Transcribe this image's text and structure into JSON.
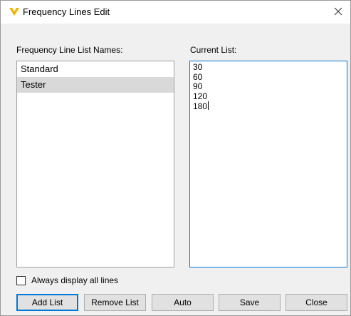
{
  "window": {
    "title": "Frequency Lines Edit"
  },
  "left_panel": {
    "label": "Frequency Line List Names:",
    "items": [
      {
        "label": "Standard",
        "selected": false
      },
      {
        "label": "Tester",
        "selected": true
      }
    ]
  },
  "right_panel": {
    "label": "Current List:",
    "lines": [
      "30",
      "60",
      "90",
      "120",
      "180"
    ]
  },
  "options": {
    "always_display_label": "Always display all lines",
    "always_display_checked": false
  },
  "buttons": {
    "add_list": "Add List",
    "remove_list": "Remove List",
    "auto": "Auto",
    "save": "Save",
    "close": "Close"
  },
  "colors": {
    "accent": "#0078d7",
    "selection": "#d9d9d9",
    "logo_gold": "#f0b400"
  },
  "icons": {
    "title": "app-logo-icon",
    "close": "close-icon"
  }
}
